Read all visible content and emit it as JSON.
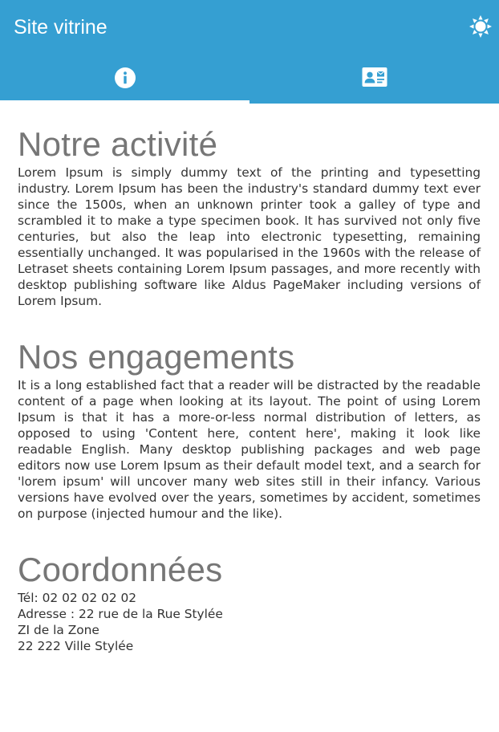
{
  "appbar": {
    "title": "Site vitrine",
    "background": "#359fd2",
    "theme_icon": "sun-icon"
  },
  "tabs": [
    {
      "icon": "info-icon",
      "active": true
    },
    {
      "icon": "contact-card-icon",
      "active": false
    }
  ],
  "sections": {
    "activity": {
      "heading": "Notre activité",
      "body": "Lorem Ipsum is simply dummy text of the printing and typesetting industry. Lorem Ipsum has been the industry's standard dummy text ever since the 1500s, when an unknown printer took a galley of type and scrambled it to make a type specimen book. It has survived not only five centuries, but also the leap into electronic typesetting, remaining essentially unchanged. It was popularised in the 1960s with the release of Letraset sheets containing Lorem Ipsum passages, and more recently with desktop publishing software like Aldus PageMaker including versions of Lorem Ipsum."
    },
    "commitments": {
      "heading": "Nos engagements",
      "body": "It is a long established fact that a reader will be distracted by the readable content of a page when looking at its layout. The point of using Lorem Ipsum is that it has a more-or-less normal distribution of letters, as opposed to using 'Content here, content here', making it look like readable English. Many desktop publishing packages and web page editors now use Lorem Ipsum as their default model text, and a search for 'lorem ipsum' will uncover many web sites still in their infancy. Various versions have evolved over the years, sometimes by accident, sometimes on purpose (injected humour and the like)."
    },
    "contact": {
      "heading": "Coordonnées",
      "phone": "Tél: 02 02 02 02 02",
      "address_line1": "Adresse : 22 rue de la Rue Stylée",
      "address_line2": "ZI de la Zone",
      "address_line3": "22 222 Ville Stylée"
    }
  }
}
